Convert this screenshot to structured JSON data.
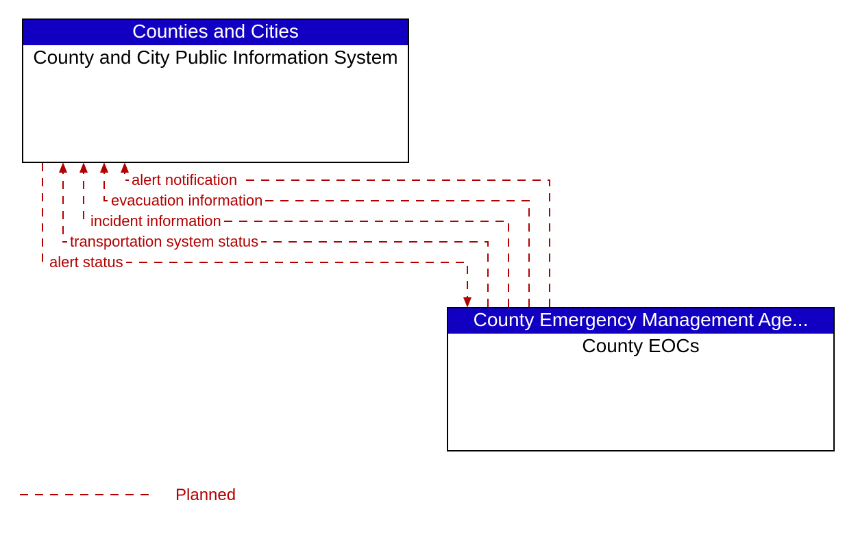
{
  "colors": {
    "header_bg": "#1100c2",
    "flow_line": "#b20000"
  },
  "nodes": {
    "top": {
      "header": "Counties and Cities",
      "body": "County and City Public Information System"
    },
    "bottom": {
      "header": "County Emergency Management Age...",
      "body": "County EOCs"
    }
  },
  "flows": [
    {
      "label": "alert notification"
    },
    {
      "label": "evacuation information"
    },
    {
      "label": "incident information"
    },
    {
      "label": "transportation system status"
    },
    {
      "label": "alert status"
    }
  ],
  "legend": {
    "planned": "Planned"
  }
}
